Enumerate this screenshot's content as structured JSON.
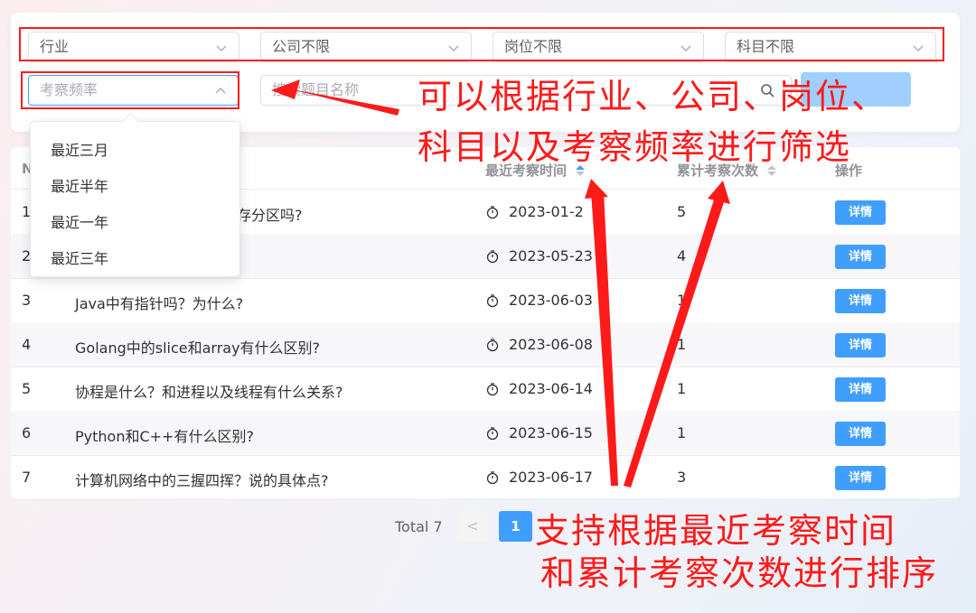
{
  "filters": {
    "industry": "行业",
    "company": "公司不限",
    "position": "岗位不限",
    "subject": "科目不限",
    "frequency": "考察频率",
    "search_placeholder": "搜索题目名称"
  },
  "frequency_options": [
    "最近三月",
    "最近半年",
    "最近一年",
    "最近三年"
  ],
  "table": {
    "col_no": "N",
    "col_time": "最近考察时间",
    "col_count": "累计考察次数",
    "col_action": "操作",
    "detail_label": "详情",
    "rows": [
      {
        "no": "1",
        "title": "存分区吗?",
        "time": "2023-01-2",
        "count": "5"
      },
      {
        "no": "2",
        "title": "",
        "time": "2023-05-23",
        "count": "4"
      },
      {
        "no": "3",
        "title": "Java中有指针吗？为什么?",
        "time": "2023-06-03",
        "count": "1"
      },
      {
        "no": "4",
        "title": "Golang中的slice和array有什么区别?",
        "time": "2023-06-08",
        "count": "1"
      },
      {
        "no": "5",
        "title": "协程是什么？和进程以及线程有什么关系?",
        "time": "2023-06-14",
        "count": "1"
      },
      {
        "no": "6",
        "title": "Python和C++有什么区别?",
        "time": "2023-06-15",
        "count": "1"
      },
      {
        "no": "7",
        "title": "计算机网络中的三握四挥？说的具体点?",
        "time": "2023-06-17",
        "count": "3"
      }
    ]
  },
  "pagination": {
    "total": "Total 7",
    "prev": "<",
    "current": "1"
  },
  "annotations": {
    "filter_line1": "可以根据行业、公司、岗位、",
    "filter_line2": "科目以及考察频率进行筛选",
    "sort_line1": "支持根据最近考察时间",
    "sort_line2": "和累计考察次数进行排序"
  },
  "colors": {
    "primary": "#409eff",
    "annotation": "#ff1a1a"
  }
}
